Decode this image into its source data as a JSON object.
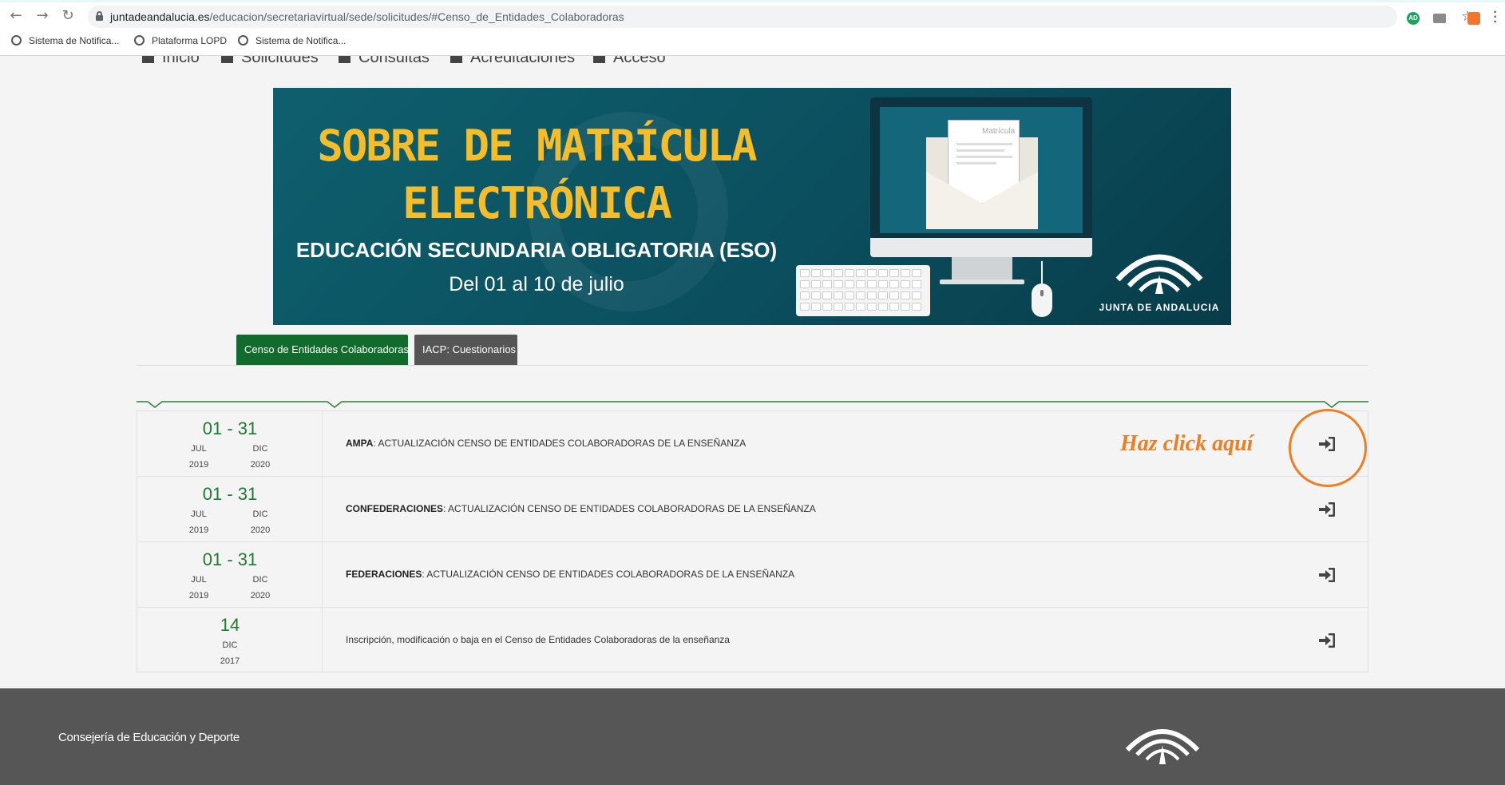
{
  "browser": {
    "url_host": "juntadeandalucia.es",
    "url_path": "/educacion/secretariavirtual/sede/solicitudes/#Censo_de_Entidades_Colaboradoras",
    "extension_badge": "AD",
    "bookmarks": [
      {
        "label": "Sistema de Notifica..."
      },
      {
        "label": "Plataforma LOPD"
      },
      {
        "label": "Sistema de Notifica..."
      }
    ]
  },
  "site_nav": {
    "items": [
      {
        "label": "Inicio"
      },
      {
        "label": "Solicitudes"
      },
      {
        "label": "Consultas"
      },
      {
        "label": "Acreditaciones"
      },
      {
        "label": "Acceso"
      }
    ]
  },
  "banner": {
    "title_line1": "SOBRE DE MATRÍCULA",
    "title_line2": "ELECTRÓNICA",
    "subtitle": "EDUCACIÓN SECUNDARIA OBLIGATORIA (ESO)",
    "dates": "Del 01 al 10 de julio",
    "paper_title": "Matrícula",
    "logo_text": "JUNTA DE ANDALUCIA"
  },
  "tabs": [
    {
      "label": "Censo de Entidades Colaboradoras",
      "active": true
    },
    {
      "label": "IACP: Cuestionarios",
      "active": false
    }
  ],
  "procedures": [
    {
      "range": "01 - 31",
      "start_month": "JUL",
      "start_year": "2019",
      "end_month": "DIC",
      "end_year": "2020",
      "title_bold": "AMPA",
      "title_rest": ": ACTUALIZACIÓN CENSO DE ENTIDADES COLABORADORAS DE LA ENSEÑANZA"
    },
    {
      "range": "01 - 31",
      "start_month": "JUL",
      "start_year": "2019",
      "end_month": "DIC",
      "end_year": "2020",
      "title_bold": "CONFEDERACIONES",
      "title_rest": ": ACTUALIZACIÓN CENSO DE ENTIDADES COLABORADORAS DE LA ENSEÑANZA"
    },
    {
      "range": "01 - 31",
      "start_month": "JUL",
      "start_year": "2019",
      "end_month": "DIC",
      "end_year": "2020",
      "title_bold": "FEDERACIONES",
      "title_rest": ": ACTUALIZACIÓN CENSO DE ENTIDADES COLABORADORAS DE LA ENSEÑANZA"
    },
    {
      "range": "14",
      "month": "DIC",
      "year": "2017",
      "title_plain": "Inscripción, modificación o baja en el Censo de Entidades Colaboradoras de la enseñanza"
    }
  ],
  "annotation": {
    "text": "Haz click aquí",
    "color": "#f07d22"
  },
  "footer": {
    "org": "Consejería de Educación y Deporte"
  },
  "colors": {
    "accent_green": "#106b2c",
    "date_green": "#1d7a2e",
    "tab_grey": "#555555",
    "footer_bg": "#565656",
    "banner_bg": "#0e5f6e",
    "banner_title": "#f6bd2a"
  },
  "icons": [
    "back-arrow-icon",
    "forward-arrow-icon",
    "reload-icon",
    "lock-icon",
    "bookmark-star-icon",
    "globe-icon",
    "home-icon",
    "pencil-icon",
    "list-icon",
    "enter-icon",
    "junta-andalucia-logo-icon",
    "menu-dots-icon"
  ]
}
